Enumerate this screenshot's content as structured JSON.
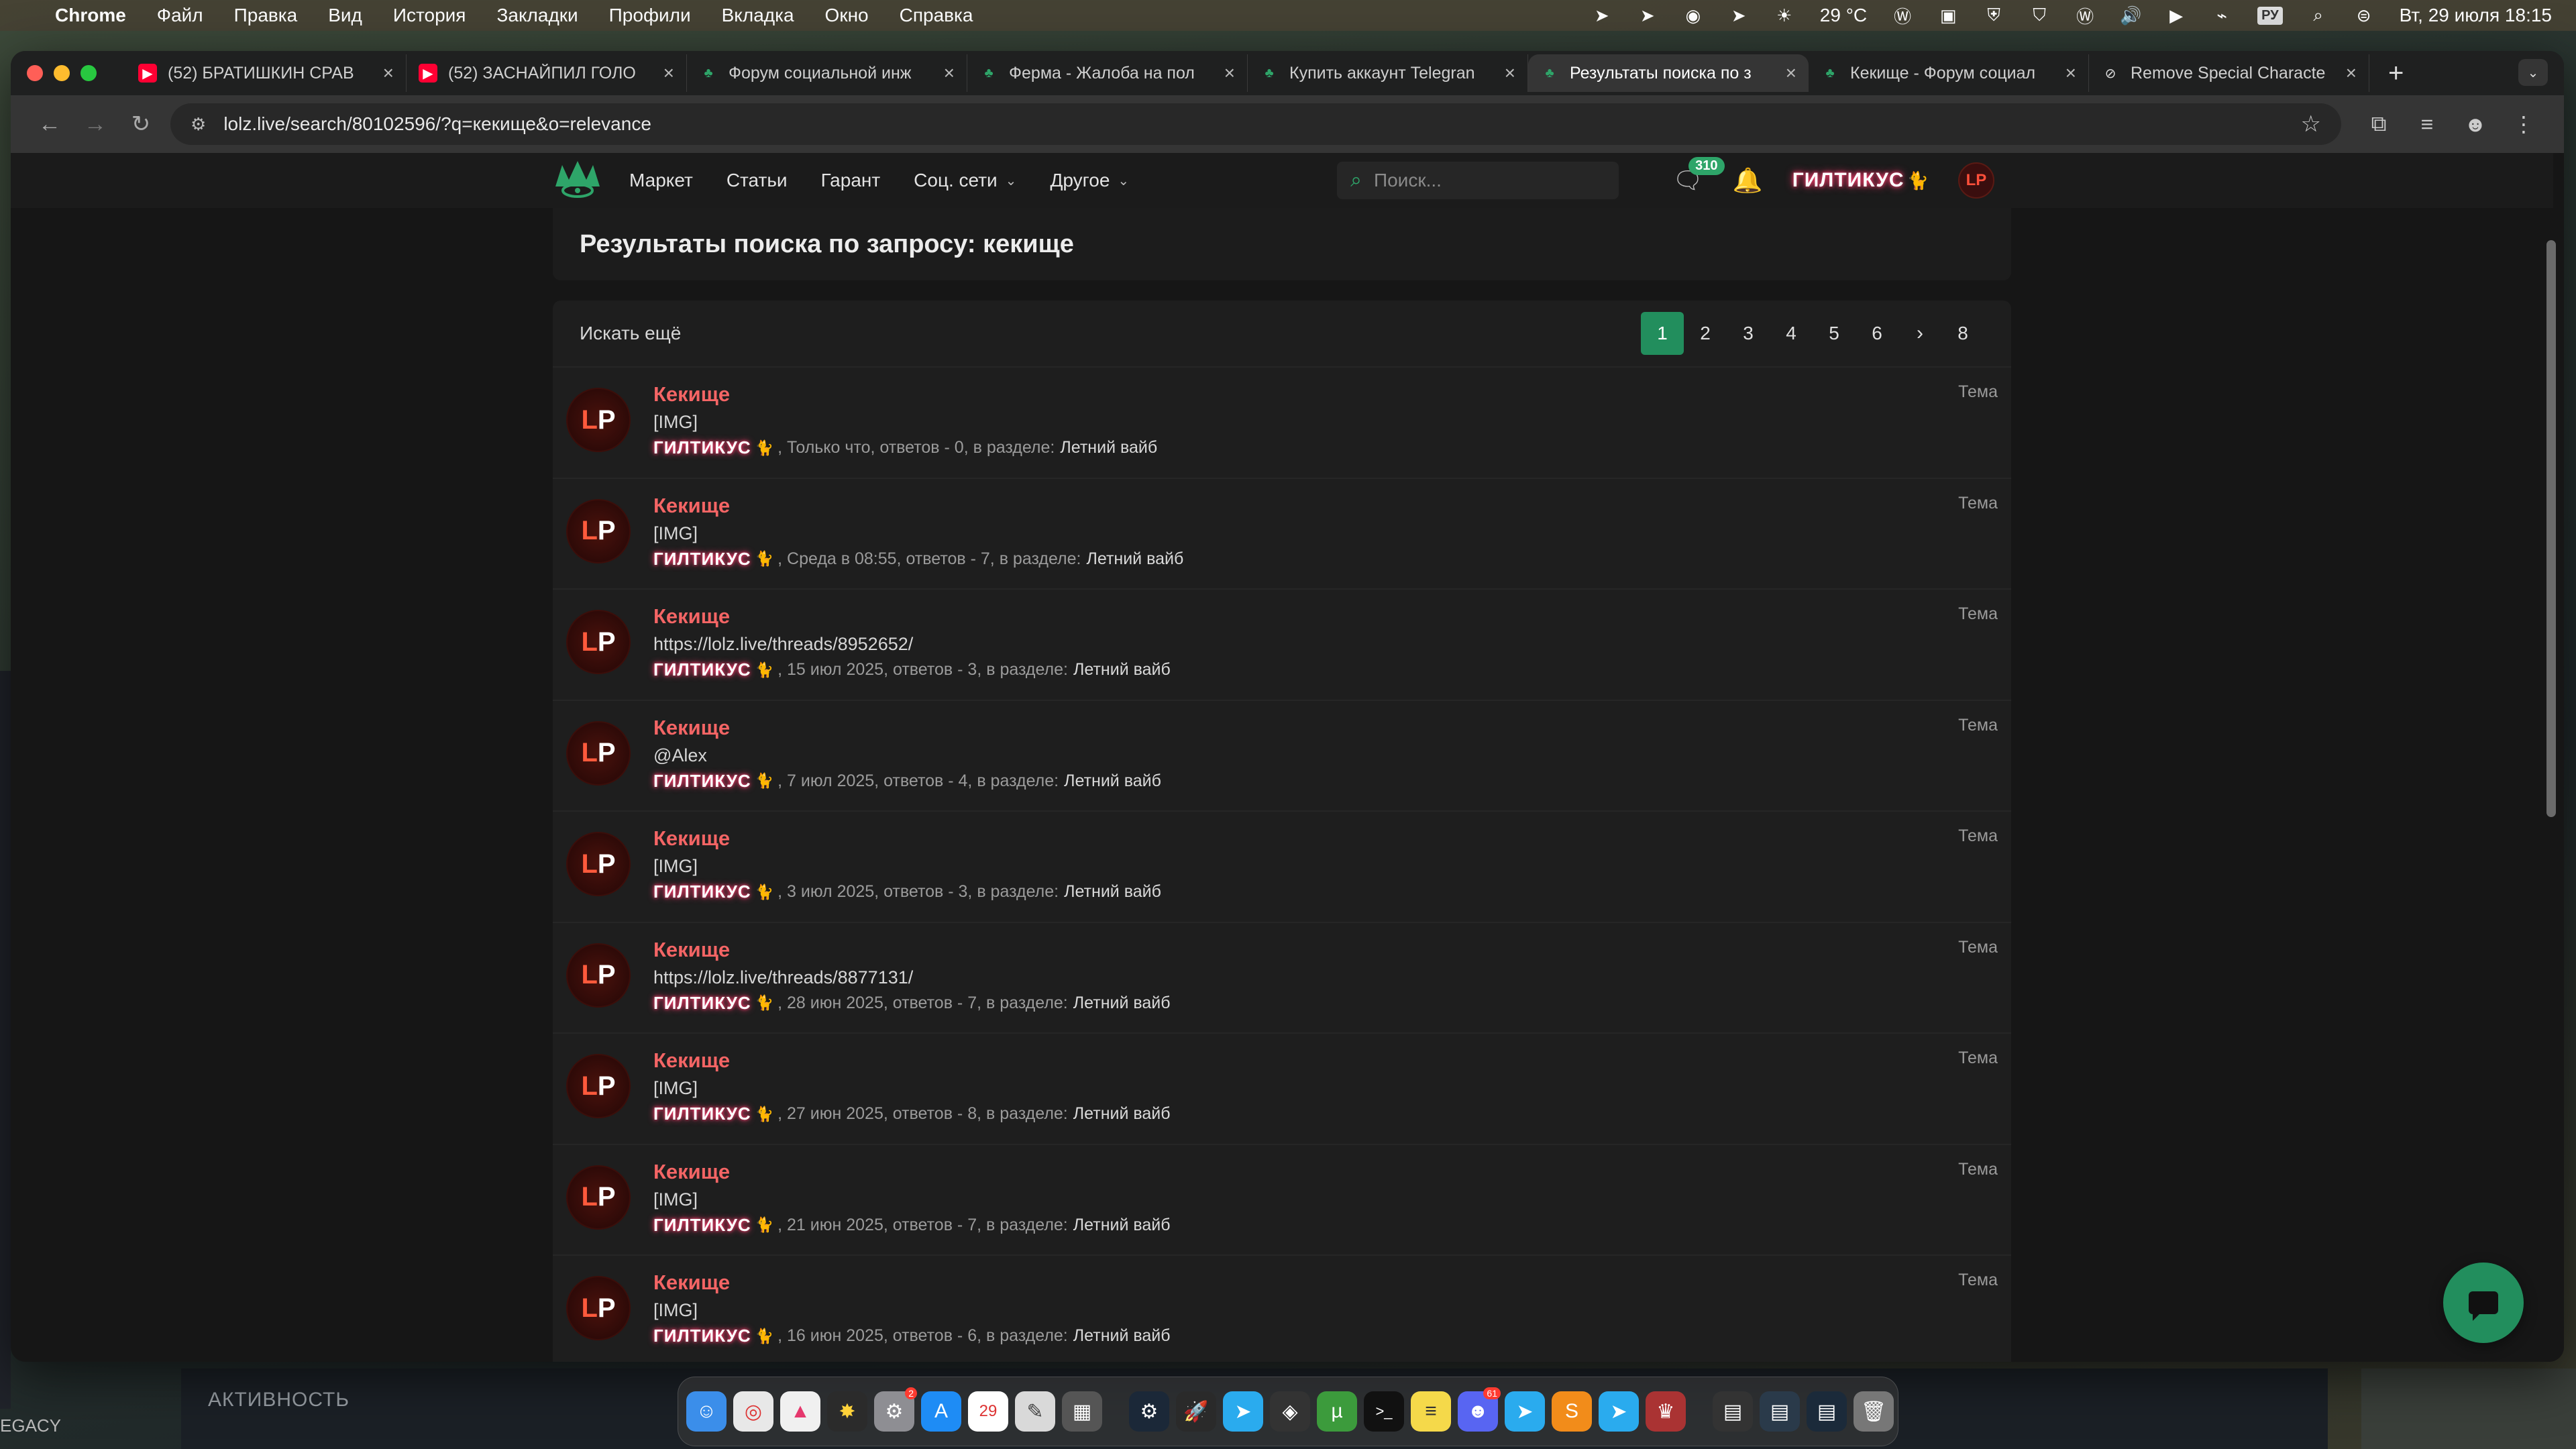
{
  "menubar": {
    "app": "Chrome",
    "items": [
      "Файл",
      "Правка",
      "Вид",
      "История",
      "Закладки",
      "Профили",
      "Вкладка",
      "Окно",
      "Справка"
    ],
    "weather": "29 °C",
    "lang": "РУ",
    "datetime": "Вт, 29 июля  18:15"
  },
  "browser": {
    "tabs": [
      {
        "title": "(52) БРАТИШКИН СРАВ",
        "icon": "youtube-icon"
      },
      {
        "title": "(52) ЗАСНАЙПИЛ ГОЛО",
        "icon": "youtube-icon"
      },
      {
        "title": "Форум социальной инж",
        "icon": "lolz-icon"
      },
      {
        "title": "Ферма - Жалоба на пол",
        "icon": "lolz-icon"
      },
      {
        "title": "Купить аккаунт Telegran",
        "icon": "lolz-icon"
      },
      {
        "title": "Результаты поиска по з",
        "icon": "lolz-icon",
        "active": true
      },
      {
        "title": "Кекище - Форум социал",
        "icon": "lolz-icon"
      },
      {
        "title": "Remove Special Characte",
        "icon": "link-icon"
      }
    ],
    "url": "lolz.live/search/80102596/?q=кекище&o=relevance"
  },
  "site": {
    "nav": [
      "Маркет",
      "Статьи",
      "Гарант",
      "Соц. сети",
      "Другое"
    ],
    "search_placeholder": "Поиск...",
    "conversations_badge": "310",
    "username": "ГИЛТИКУС",
    "avatar_text": "LP"
  },
  "page": {
    "title": "Результаты поиска по запросу: кекище",
    "search_more": "Искать ещё",
    "pages": [
      "1",
      "2",
      "3",
      "4",
      "5",
      "6",
      "›",
      "8"
    ]
  },
  "results": [
    {
      "title": "Кекище",
      "snippet": "[IMG]",
      "author": "ГИЛТИКУС",
      "meta": ", Только что, ответов - 0, в разделе:",
      "section": "Летний вайб",
      "type": "Тема"
    },
    {
      "title": "Кекище",
      "snippet": "[IMG]",
      "author": "ГИЛТИКУС",
      "meta": ", Среда в 08:55, ответов - 7, в разделе:",
      "section": "Летний вайб",
      "type": "Тема"
    },
    {
      "title": "Кекище",
      "snippet": "https://lolz.live/threads/8952652/",
      "author": "ГИЛТИКУС",
      "meta": ", 15 июл 2025, ответов - 3, в разделе:",
      "section": "Летний вайб",
      "type": "Тема"
    },
    {
      "title": "Кекище",
      "snippet": "@Alex",
      "author": "ГИЛТИКУС",
      "meta": ", 7 июл 2025, ответов - 4, в разделе:",
      "section": "Летний вайб",
      "type": "Тема"
    },
    {
      "title": "Кекище",
      "snippet": "[IMG]",
      "author": "ГИЛТИКУС",
      "meta": ", 3 июл 2025, ответов - 3, в разделе:",
      "section": "Летний вайб",
      "type": "Тема"
    },
    {
      "title": "Кекище",
      "snippet": "https://lolz.live/threads/8877131/",
      "author": "ГИЛТИКУС",
      "meta": ", 28 июн 2025, ответов - 7, в разделе:",
      "section": "Летний вайб",
      "type": "Тема"
    },
    {
      "title": "Кекище",
      "snippet": "[IMG]",
      "author": "ГИЛТИКУС",
      "meta": ", 27 июн 2025, ответов - 8, в разделе:",
      "section": "Летний вайб",
      "type": "Тема"
    },
    {
      "title": "Кекище",
      "snippet": "[IMG]",
      "author": "ГИЛТИКУС",
      "meta": ", 21 июн 2025, ответов - 7, в разделе:",
      "section": "Летний вайб",
      "type": "Тема"
    },
    {
      "title": "Кекище",
      "snippet": "[IMG]",
      "author": "ГИЛТИКУС",
      "meta": ", 16 июн 2025, ответов - 6, в разделе:",
      "section": "Летний вайб",
      "type": "Тема"
    }
  ],
  "desktop": {
    "activity_label": "АКТИВНОСТЬ",
    "legacy_label": "EGACY"
  },
  "colors": {
    "accent_green": "#228e5d",
    "title_red": "#f46565",
    "username_glow": "#ff3d6e"
  }
}
